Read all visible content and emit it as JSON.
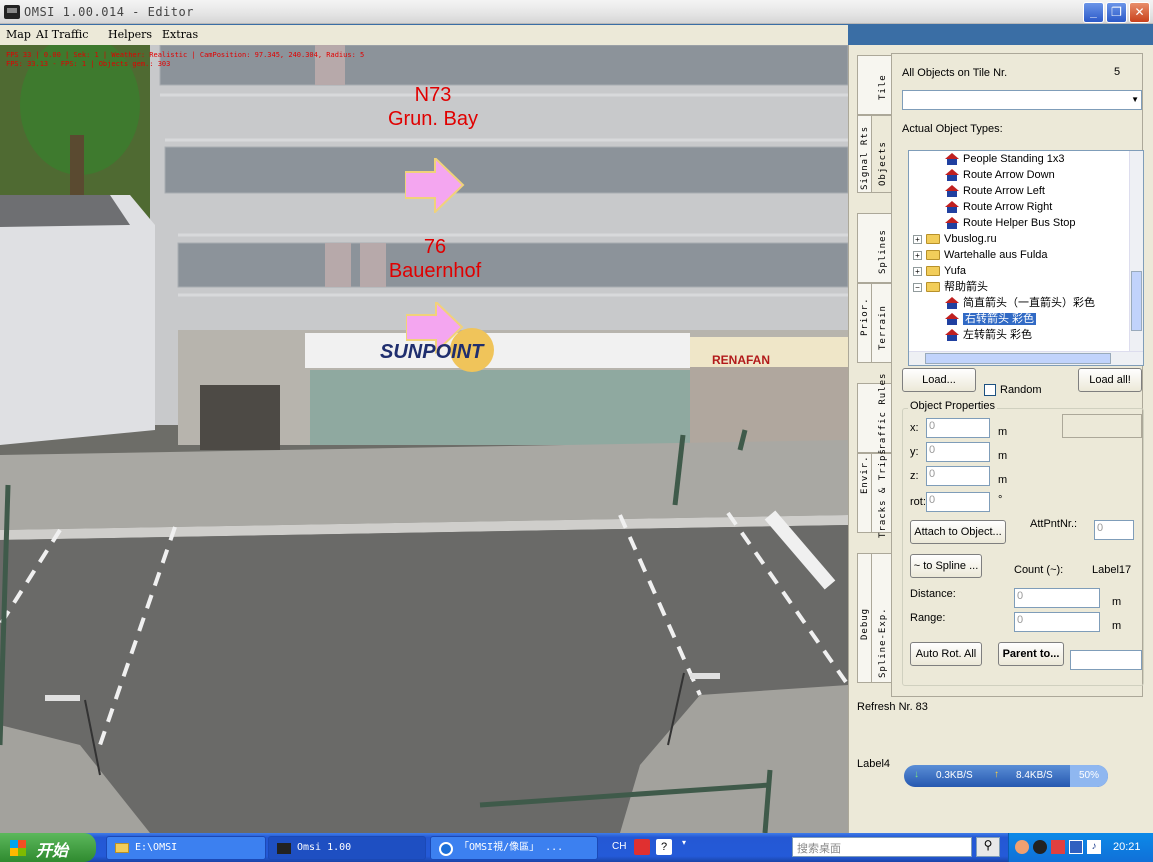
{
  "window": {
    "title": "OMSI 1.00.014 - Editor",
    "minimize_label": "_",
    "maximize_label": "❐",
    "close_label": "✕"
  },
  "menu": [
    "Map",
    "AI Traffic",
    "Helpers",
    "Extras"
  ],
  "viewport": {
    "debug_line_1": "FPS 33 | 0.00 | Sek: 1 | Weather: Realistic | CamPosition: 97.345, 240.304, Radius: 5",
    "debug_line_2": "FPS: 33.13 - FPS: 1 | Objects gem.: 303",
    "sign1_line1": "N73",
    "sign1_line2": "Grun. Bay",
    "sign2_line1": "76",
    "sign2_line2": "Bauernhof",
    "shop_sign": "SUNPOINT",
    "shop_sign2": "RENAFAN"
  },
  "vertical_tabs": [
    "Tile",
    "Objects",
    "Signal Rts",
    "Splines",
    "Terrain",
    "Prior.",
    "Traffic Rules",
    "Envir.",
    "Tracks & Trips",
    "Spline-Exp.",
    "Debug"
  ],
  "objects_panel": {
    "all_objects_label": "All Objects on Tile Nr.",
    "tile_nr": "5",
    "actual_types_label": "Actual Object Types:",
    "tree": [
      {
        "type": "item",
        "label": "People Standing 1x3"
      },
      {
        "type": "item",
        "label": "Route Arrow Down"
      },
      {
        "type": "item",
        "label": "Route Arrow Left"
      },
      {
        "type": "item",
        "label": "Route Arrow Right"
      },
      {
        "type": "item",
        "label": "Route Helper Bus Stop"
      },
      {
        "type": "folder",
        "label": "Vbuslog.ru"
      },
      {
        "type": "folder",
        "label": "Wartehalle aus Fulda"
      },
      {
        "type": "folder",
        "label": "Yufa"
      },
      {
        "type": "folder-open",
        "label": "帮助箭头"
      },
      {
        "type": "item",
        "label": "简直箭头（一直箭头）彩色"
      },
      {
        "type": "item",
        "label": "右转箭头 彩色"
      },
      {
        "type": "item",
        "label": "左转箭头 彩色"
      }
    ],
    "selected_index": 10,
    "load_button": "Load...",
    "random_label": "Random",
    "load_all_button": "Load all!",
    "properties_label": "Object Properties",
    "x_label": "x:",
    "y_label": "y:",
    "z_label": "z:",
    "rot_label": "rot:",
    "x_value": "0",
    "y_value": "0",
    "z_value": "0",
    "rot_value": "0",
    "unit_m": "m",
    "unit_deg": "°",
    "attach_button": "Attach to Object...",
    "att_pnt_label": "AttPntNr.:",
    "att_pnt_value": "0",
    "to_spline_button": "~ to Spline ...",
    "count_label": "Count (~):",
    "count_value": "Label17",
    "distance_label": "Distance:",
    "distance_value": "0",
    "range_label": "Range:",
    "range_value": "0",
    "auto_rot_button": "Auto Rot. All",
    "parent_button": "Parent to..."
  },
  "status": {
    "refresh_label": "Refresh Nr. 83",
    "label4": "Label4",
    "download_speed": "0.3KB/S",
    "upload_speed": "8.4KB/S",
    "cpu": "50%"
  },
  "taskbar": {
    "start_label": "开始",
    "tasks": [
      "E:\\OMSI",
      "Omsi 1.00",
      "「OMSI視/像區」 ..."
    ],
    "lang": "CH",
    "search_placeholder": "搜索桌面",
    "clock": "20:21"
  },
  "colors": {
    "route_label_red": "#e00000",
    "arrow_pink": "#f4a6f0",
    "taskbar_blue": "#245ad8",
    "start_green": "#3c9a3c",
    "selection_blue": "#316ac5"
  }
}
